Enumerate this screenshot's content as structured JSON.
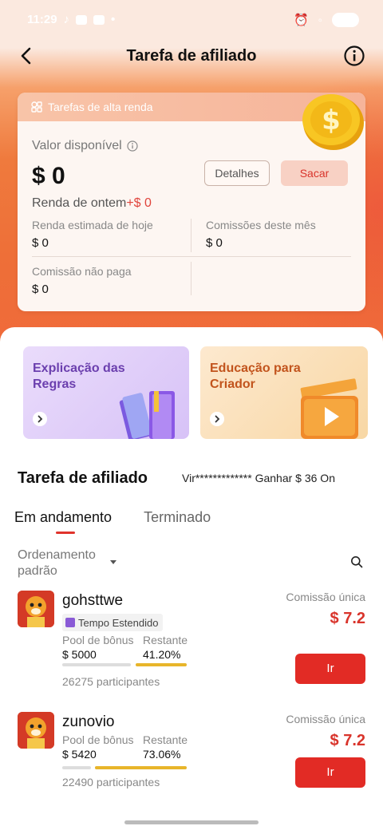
{
  "status_bar": {
    "time": "11:29",
    "battery": ""
  },
  "header": {
    "title": "Tarefa de afiliado"
  },
  "card": {
    "head_label": "Tarefas de alta renda",
    "available_label": "Valor disponível",
    "available_value": "$ 0",
    "details_button": "Detalhes",
    "withdraw_button": "Sacar",
    "yesterday_label": "Renda de ontem",
    "yesterday_value": "+$ 0",
    "stats": [
      {
        "label": "Renda estimada de hoje",
        "value": "$ 0"
      },
      {
        "label": "Comissões deste mês",
        "value": "$ 0"
      },
      {
        "label": "Comissão não paga",
        "value": "$ 0"
      }
    ]
  },
  "banners": [
    {
      "title": "Explicação das Regras"
    },
    {
      "title": "Educação para Criador"
    }
  ],
  "section": {
    "title": "Tarefa de afiliado",
    "marquee": "Vir************* Ganhar $ 36 On"
  },
  "tabs": [
    {
      "label": "Em andamento",
      "active": true
    },
    {
      "label": "Terminado",
      "active": false
    }
  ],
  "sort": {
    "label": "Ordenamento padrão"
  },
  "tasks": [
    {
      "name": "gohsttwe",
      "tag": "Tempo Estendido",
      "pool_label": "Pool de bônus",
      "pool_value": "$ 5000",
      "remaining_label": "Restante",
      "remaining_value": "41.20%",
      "remaining_fraction": 0.412,
      "participants": "26275 participantes",
      "commission_label": "Comissão única",
      "commission_value": "$ 7.2",
      "button": "Ir"
    },
    {
      "name": "zunovio",
      "tag": "",
      "pool_label": "Pool de bônus",
      "pool_value": "$ 5420",
      "remaining_label": "Restante",
      "remaining_value": "73.06%",
      "remaining_fraction": 0.7306,
      "participants": "22490 participantes",
      "commission_label": "Comissão única",
      "commission_value": "$ 7.2",
      "button": "Ir"
    }
  ],
  "colors": {
    "accent": "#e22b25",
    "progress": "#e8b52a"
  }
}
